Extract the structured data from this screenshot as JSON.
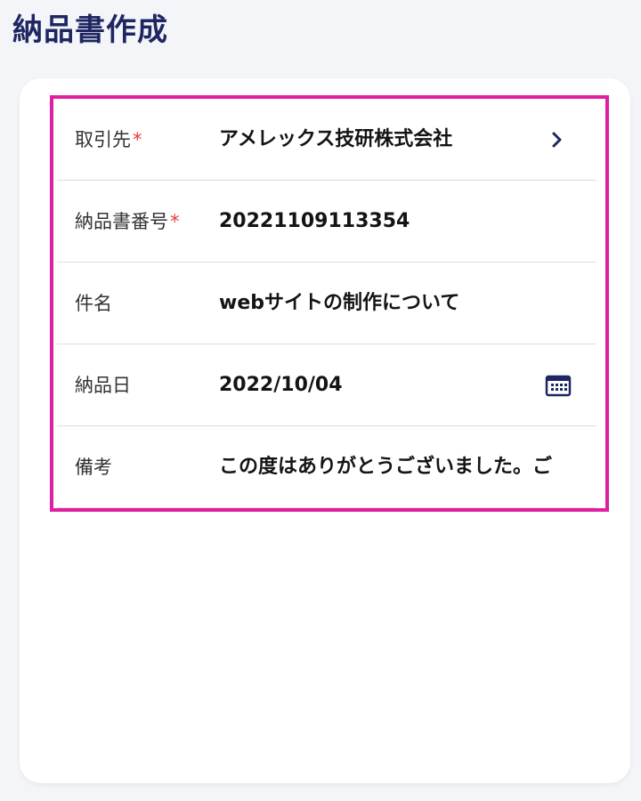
{
  "page": {
    "title": "納品書作成"
  },
  "form": {
    "client": {
      "label": "取引先",
      "required_mark": "*",
      "value": "アメレックス技研株式会社",
      "icon": "chevron-right-icon"
    },
    "invoice_number": {
      "label": "納品書番号",
      "required_mark": "*",
      "value": "20221109113354"
    },
    "subject": {
      "label": "件名",
      "value": "webサイトの制作について"
    },
    "delivery_date": {
      "label": "納品日",
      "value": "2022/10/04",
      "icon": "calendar-icon"
    },
    "remarks": {
      "label": "備考",
      "value": "この度はありがとうございました。ご"
    }
  },
  "colors": {
    "title": "#1f2762",
    "required": "#e23b3b",
    "highlight_border": "#e01fa0",
    "icon": "#1f2762"
  }
}
